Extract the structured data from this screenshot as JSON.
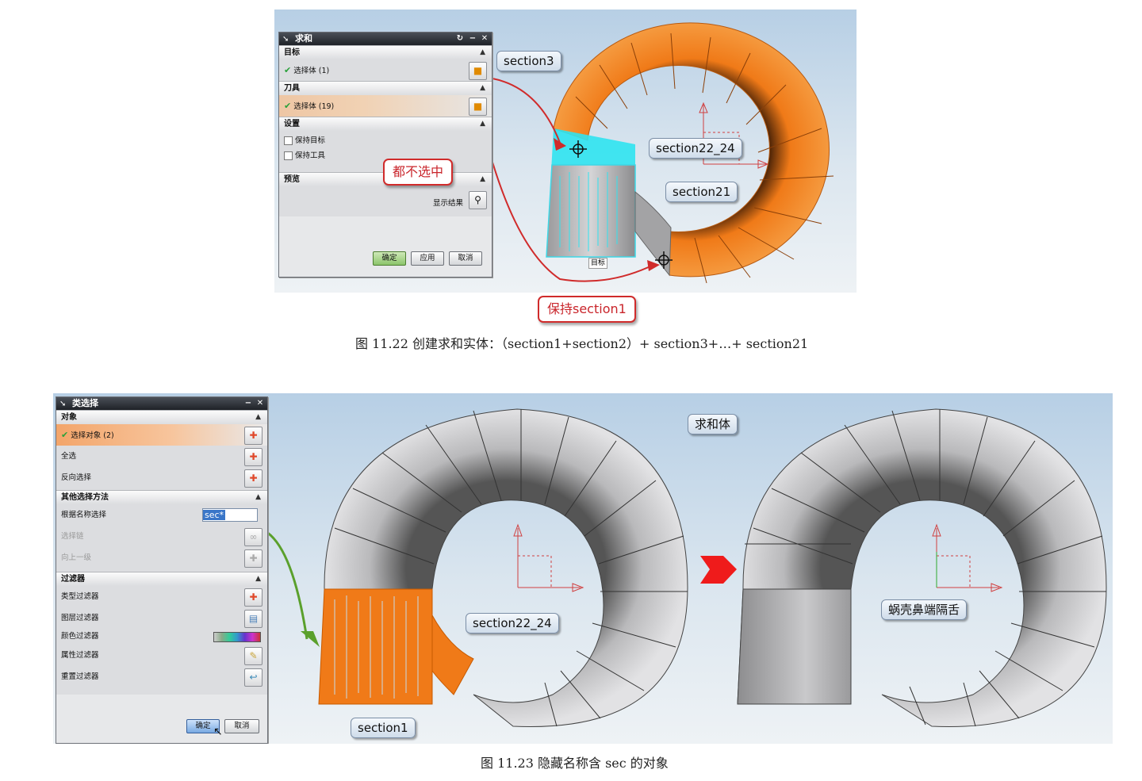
{
  "figure1": {
    "dialog": {
      "title": "求和",
      "sections": {
        "target": {
          "header": "目标",
          "row": "选择体 (1)"
        },
        "tool": {
          "header": "刀具",
          "row": "选择体 (19)"
        },
        "settings": {
          "header": "设置",
          "keep_target": "保持目标",
          "keep_tool": "保持工具"
        },
        "preview": {
          "header": "预览",
          "show_result": "显示结果"
        }
      },
      "buttons": {
        "ok": "确定",
        "apply": "应用",
        "cancel": "取消"
      }
    },
    "annotations": {
      "none_selected": "都不选中",
      "keep_section1": "保持section1",
      "section3": "section3",
      "section22_24": "section22_24",
      "section21": "section21",
      "target_tag": "目标"
    },
    "caption": "图 11.22 创建求和实体：（section1+section2）+ section3+…+ section21"
  },
  "figure2": {
    "dialog": {
      "title": "类选择",
      "sections": {
        "object": {
          "header": "对象",
          "selected": "选择对象 (2)",
          "select_all": "全选",
          "invert": "反向选择"
        },
        "other": {
          "header": "其他选择方法",
          "by_name": "根据名称选择",
          "name_value": "sec*",
          "select_chain": "选择链",
          "up_level": "向上一级"
        },
        "filters": {
          "header": "过滤器",
          "type": "类型过滤器",
          "layer": "图层过滤器",
          "color": "颜色过滤器",
          "attribute": "属性过滤器",
          "reset": "重置过滤器"
        }
      },
      "buttons": {
        "ok": "确定",
        "cancel": "取消"
      }
    },
    "annotations": {
      "section22_24": "section22_24",
      "section1": "section1",
      "sum_body": "求和体",
      "volute_tongue": "蜗壳鼻端隔舌"
    },
    "caption": "图 11.23 隐藏名称含 sec 的对象"
  },
  "colors": {
    "orange": "#f07a18",
    "cyan": "#2fe3ef",
    "red": "#d02b2b",
    "green_arrow": "#5aa02c",
    "gray_body": "#9a9a9c"
  }
}
